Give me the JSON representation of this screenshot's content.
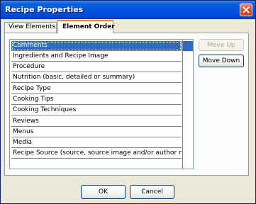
{
  "window": {
    "title": "Recipe Properties"
  },
  "tabs": [
    {
      "label": "View Elements",
      "active": false
    },
    {
      "label": "Element Order",
      "active": true
    }
  ],
  "element_list": {
    "selected_index": 0,
    "items": [
      "Comments",
      "Ingredients and Recipe Image",
      "Procedure",
      "Nutrition (basic, detailed or summary)",
      "Recipe Type",
      "Cooking Tips",
      "Cooking Techniques",
      "Reviews",
      "Menus",
      "Media",
      "Recipe Source (source, source image and/or author notes)"
    ]
  },
  "order_buttons": {
    "move_up_label": "Move Up",
    "move_up_enabled": false,
    "move_down_label": "Move Down",
    "move_down_enabled": true
  },
  "footer": {
    "ok_label": "OK",
    "cancel_label": "Cancel"
  },
  "colors": {
    "title_bar": "#0054e3",
    "selection": "#316ac5",
    "active_tab_accent": "#e68b2c",
    "close_button": "#d8502e"
  },
  "icons": {
    "close": "close-icon"
  }
}
